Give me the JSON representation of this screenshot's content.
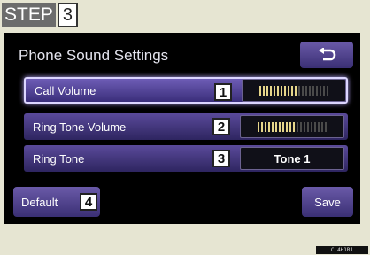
{
  "step": {
    "label": "STEP",
    "number": "3"
  },
  "screen": {
    "title": "Phone Sound Settings",
    "back_icon": "return-arrow-icon"
  },
  "rows": [
    {
      "label": "Call Volume",
      "number": "1",
      "level": 0.55,
      "selected": true
    },
    {
      "label": "Ring Tone Volume",
      "number": "2",
      "level": 0.55,
      "selected": false
    },
    {
      "label": "Ring Tone",
      "number": "3",
      "value": "Tone 1",
      "selected": false
    }
  ],
  "footer": {
    "default_label": "Default",
    "default_number": "4",
    "save_label": "Save"
  },
  "image_code": "CL4H1R1"
}
